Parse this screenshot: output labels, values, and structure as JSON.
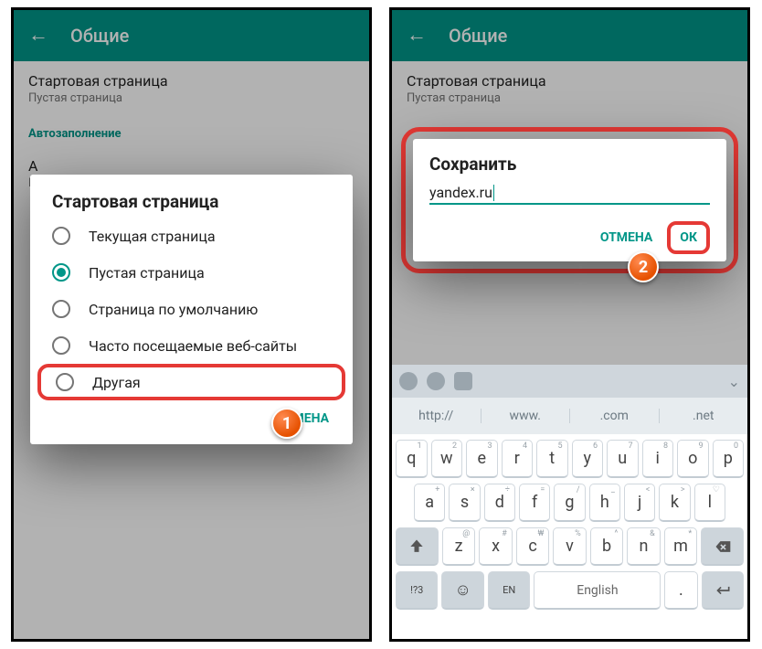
{
  "header": {
    "title": "Общие"
  },
  "settings": {
    "start_title": "Стартовая страница",
    "start_sub": "Пустая страница",
    "autofill": "Автозаполнение",
    "row_a": "А",
    "row_b": "Б"
  },
  "dialog1": {
    "title": "Стартовая страница",
    "options": [
      "Текущая страница",
      "Пустая страница",
      "Страница по умолчанию",
      "Часто посещаемые веб-сайты",
      "Другая"
    ],
    "selected_index": 1,
    "cancel": "ОТМЕНА",
    "step_badge": "1"
  },
  "dialog2": {
    "title": "Сохранить",
    "value": "yandex.ru",
    "cancel": "ОТМЕНА",
    "ok": "ОК",
    "step_badge": "2"
  },
  "keyboard": {
    "suggestions": [
      "http://",
      "www.",
      ".com",
      ".net"
    ],
    "row1": [
      "q",
      "w",
      "e",
      "r",
      "t",
      "y",
      "u",
      "i",
      "o",
      "p"
    ],
    "row1_sup": [
      "1",
      "2",
      "3",
      "4",
      "5",
      "6",
      "7",
      "8",
      "9",
      "0"
    ],
    "row2": [
      "a",
      "s",
      "d",
      "f",
      "g",
      "h",
      "j",
      "k",
      "l"
    ],
    "row2_sup": [
      "+",
      "×",
      "÷",
      "=",
      "/",
      "_",
      "<",
      ">",
      "♡"
    ],
    "row3": [
      "z",
      "x",
      "c",
      "v",
      "b",
      "n",
      "m"
    ],
    "row3_sup": [
      "@",
      "#",
      "₩",
      "%",
      "^",
      "&",
      "*"
    ],
    "sym": "!?3",
    "lang": "EN",
    "space": "English",
    "period": "."
  }
}
